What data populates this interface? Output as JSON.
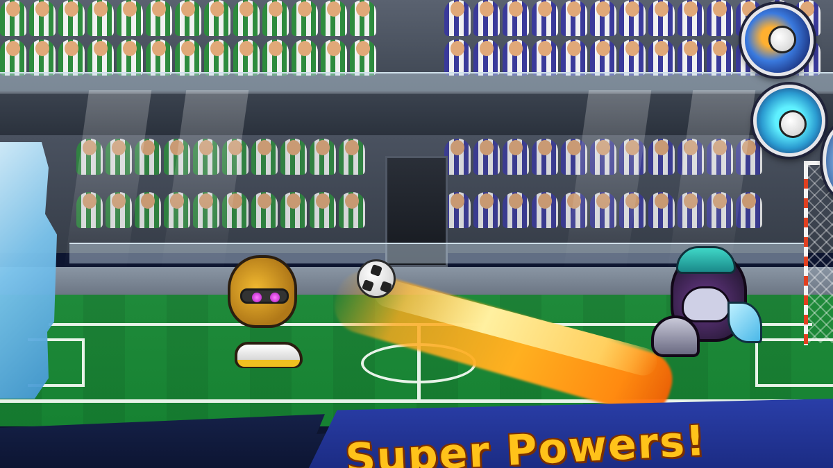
{
  "scene": {
    "stadium": "soccer-stadium",
    "home_team_colors": [
      "#2e8b3e",
      "#f1f1f1"
    ],
    "away_team_colors": [
      "#3a3a9a",
      "#f1f1f1"
    ],
    "pitch_color": "#1f8a3a"
  },
  "players": {
    "left": {
      "character": "golden-robot-skull-head",
      "accent": "#f0b830"
    },
    "right": {
      "character": "purple-yeti-head-teal-hair",
      "accent": "#6a3a8a"
    }
  },
  "ball": {
    "state": "fire-shot",
    "trail_color": "#ffb020"
  },
  "powers": [
    {
      "icon": "fireball-power-icon"
    },
    {
      "icon": "ghost-ball-power-icon"
    },
    {
      "icon": "partial-power-icon"
    }
  ],
  "banner": {
    "text": "Super Powers!",
    "color": "#ffc21a"
  }
}
